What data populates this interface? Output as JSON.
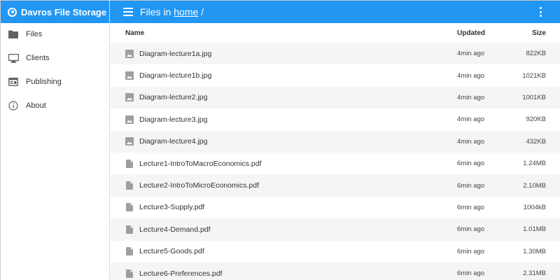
{
  "app": {
    "title": "Davros File Storage"
  },
  "sidebar": {
    "items": [
      {
        "label": "Files",
        "icon": "folder-icon"
      },
      {
        "label": "Clients",
        "icon": "monitor-icon"
      },
      {
        "label": "Publishing",
        "icon": "web-icon"
      },
      {
        "label": "About",
        "icon": "info-icon"
      }
    ]
  },
  "header": {
    "prefix": "Files in",
    "crumb": "home",
    "separator": "/"
  },
  "table": {
    "columns": {
      "name": "Name",
      "updated": "Updated",
      "size": "Size"
    },
    "rows": [
      {
        "name": "Diagram-lecture1a.jpg",
        "updated": "4min ago",
        "size": "822KB",
        "icon": "image-icon"
      },
      {
        "name": "Diagram-lecture1b.jpg",
        "updated": "4min ago",
        "size": "1021KB",
        "icon": "image-icon"
      },
      {
        "name": "Diagram-lecture2.jpg",
        "updated": "4min ago",
        "size": "1001KB",
        "icon": "image-icon"
      },
      {
        "name": "Diagram-lecture3.jpg",
        "updated": "4min ago",
        "size": "920KB",
        "icon": "image-icon"
      },
      {
        "name": "Diagram-lecture4.jpg",
        "updated": "4min ago",
        "size": "432KB",
        "icon": "image-icon"
      },
      {
        "name": "Lecture1-IntroToMacroEconomics.pdf",
        "updated": "6min ago",
        "size": "1.24MB",
        "icon": "document-icon"
      },
      {
        "name": "Lecture2-IntroToMicroEconomics.pdf",
        "updated": "6min ago",
        "size": "2.10MB",
        "icon": "document-icon"
      },
      {
        "name": "Lecture3-Supply.pdf",
        "updated": "6min ago",
        "size": "1004kB",
        "icon": "document-icon"
      },
      {
        "name": "Lecture4-Demand.pdf",
        "updated": "6min ago",
        "size": "1.01MB",
        "icon": "document-icon"
      },
      {
        "name": "Lecture5-Goods.pdf",
        "updated": "6min ago",
        "size": "1.30MB",
        "icon": "document-icon"
      },
      {
        "name": "Lecture6-Preferences.pdf",
        "updated": "6min ago",
        "size": "2.31MB",
        "icon": "document-icon"
      }
    ]
  },
  "colors": {
    "primary": "#2196f3",
    "stripe": "#f5f5f5",
    "icon": "#9e9e9e"
  }
}
